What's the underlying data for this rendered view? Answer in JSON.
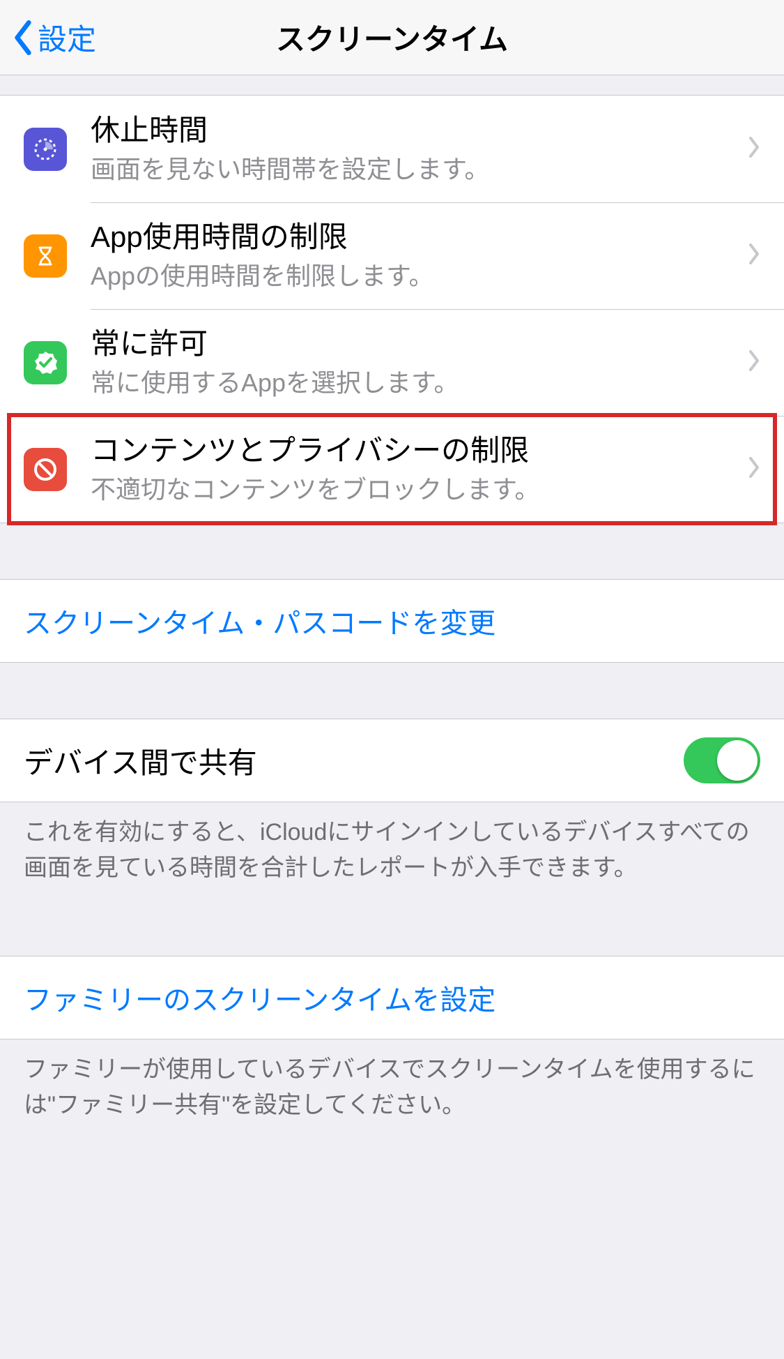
{
  "nav": {
    "back": "設定",
    "title": "スクリーンタイム"
  },
  "rows": {
    "downtime": {
      "title": "休止時間",
      "sub": "画面を見ない時間帯を設定します。"
    },
    "applimit": {
      "title": "App使用時間の制限",
      "sub": "Appの使用時間を制限します。"
    },
    "allowed": {
      "title": "常に許可",
      "sub": "常に使用するAppを選択します。"
    },
    "content": {
      "title": "コンテンツとプライバシーの制限",
      "sub": "不適切なコンテンツをブロックします。"
    }
  },
  "passcode_link": "スクリーンタイム・パスコードを変更",
  "share": {
    "label": "デバイス間で共有",
    "on": true,
    "footer": "これを有効にすると、iCloudにサインインしているデバイスすべての画面を見ている時間を合計したレポートが入手できます。"
  },
  "family": {
    "link": "ファミリーのスクリーンタイムを設定",
    "footer": "ファミリーが使用しているデバイスでスクリーンタイムを使用するには\"ファミリー共有\"を設定してください。"
  }
}
